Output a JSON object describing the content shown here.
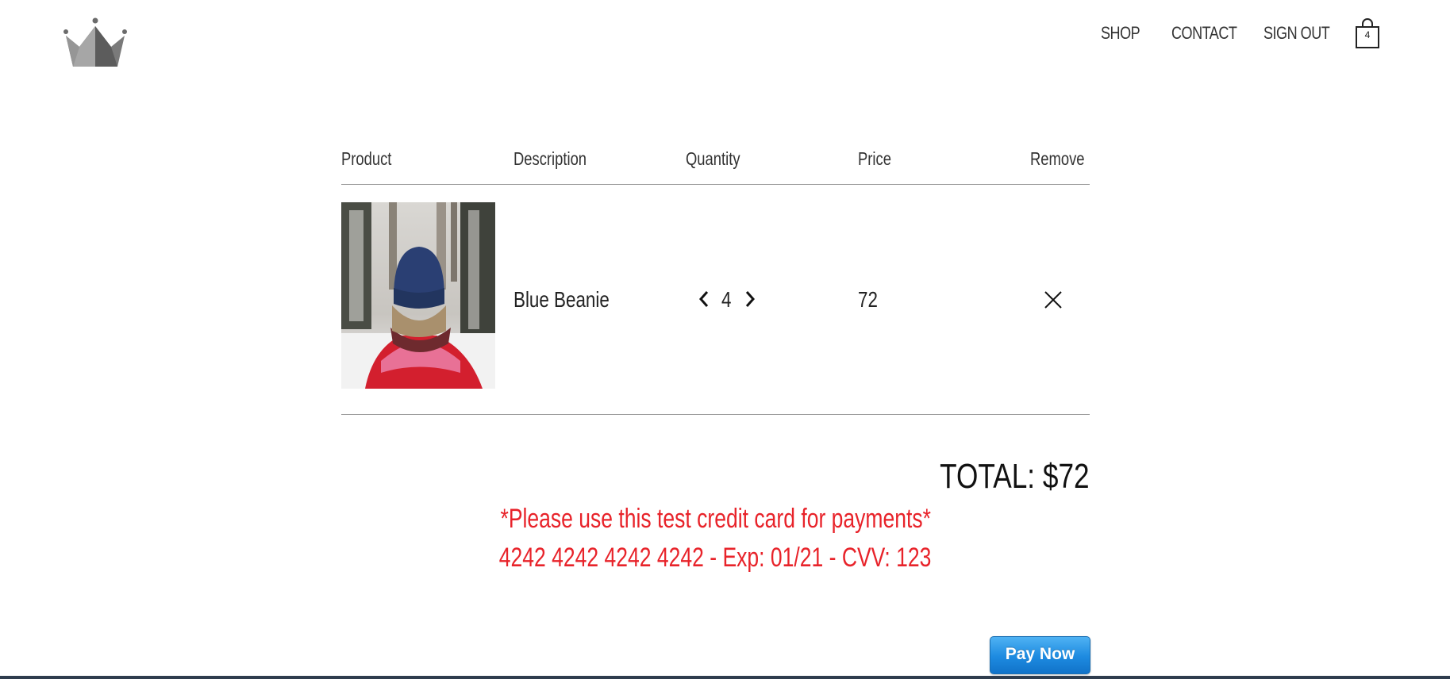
{
  "header": {
    "logo_name": "crown-logo",
    "nav": [
      {
        "label": "SHOP"
      },
      {
        "label": "CONTACT"
      },
      {
        "label": "SIGN OUT"
      }
    ],
    "cart": {
      "icon": "shopping-bag-icon",
      "count": "4"
    }
  },
  "cart_table": {
    "headers": {
      "product": "Product",
      "description": "Description",
      "quantity": "Quantity",
      "price": "Price",
      "remove": "Remove"
    },
    "rows": [
      {
        "image": "product-image-blue-beanie",
        "description": "Blue Beanie",
        "quantity": "4",
        "price": "72",
        "remove_icon": "close-icon"
      }
    ]
  },
  "summary": {
    "total": "TOTAL: $72"
  },
  "notice": {
    "line1": "*Please use this test credit card for payments*",
    "line2": "4242 4242 4242 4242 - Exp: 01/21 - CVV: 123"
  },
  "payment": {
    "button_label": "Pay Now"
  },
  "colors": {
    "notice_red": "#e8232a",
    "pay_button_blue": "#1d8ae0",
    "rule_gray": "#9a9a9a",
    "logo_gray": "#6b6b6b"
  }
}
